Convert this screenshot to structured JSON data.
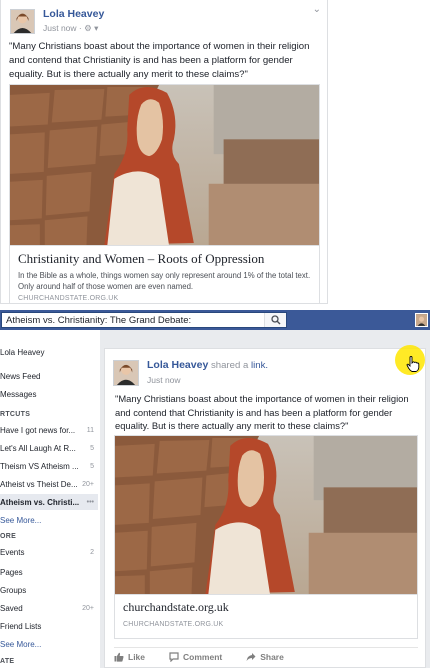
{
  "top_post": {
    "author": "Lola Heavey",
    "time": "Just now",
    "privacy_glyph": "· ⚙ ▾",
    "text": "\"Many Christians boast about the importance of women in their religion and contend that Christianity is and has been a platform for gender equality. But is there actually any merit to these claims?\"",
    "link_title": "Christianity and Women – Roots of Oppression",
    "link_description": "In the Bible as a whole, things women say only represent around 1% of the total text. Only around half of those women are even named.",
    "link_domain": "CHURCHANDSTATE.ORG.UK"
  },
  "header": {
    "search_value": "Atheism vs. Christianity: The Grand Debate:",
    "search_icon": "search-icon"
  },
  "sidebar": {
    "profile": "Lola Heavey",
    "news_feed": "News Feed",
    "messages": "Messages",
    "shortcuts_heading": "RTCUTS",
    "shortcuts": [
      {
        "label": "Have I got news for...",
        "count": "11"
      },
      {
        "label": "Let's All Laugh At R...",
        "count": "5"
      },
      {
        "label": "Theism VS Atheism ...",
        "count": "5"
      },
      {
        "label": "Atheist vs Theist De...",
        "count": "20+"
      },
      {
        "label": "Atheism vs. Christi...",
        "count": "•••"
      }
    ],
    "shortcuts_more": "See More...",
    "explore_heading": "ORE",
    "explore": [
      {
        "label": "Events",
        "count": "2"
      },
      {
        "label": "Pages",
        "count": ""
      },
      {
        "label": "Groups",
        "count": ""
      },
      {
        "label": "Saved",
        "count": "20+"
      },
      {
        "label": "Friend Lists",
        "count": ""
      }
    ],
    "explore_more": "See More...",
    "create_heading": "ATE"
  },
  "feed_post": {
    "author": "Lola Heavey",
    "shared_prefix": " shared a ",
    "shared_link": "link.",
    "time": "Just now",
    "text": "\"Many Christians boast about the importance of women in their religion and contend that Christianity is and has been a platform for gender equality. But is there actually any merit to these claims?\"",
    "link_title": "churchandstate.org.uk",
    "link_domain": "CHURCHANDSTATE.ORG.UK",
    "actions": {
      "like": "Like",
      "comment": "Comment",
      "share": "Share"
    }
  },
  "colors": {
    "brand": "#3b5998",
    "link": "#365899",
    "cursor_highlight": "#ffe600"
  }
}
